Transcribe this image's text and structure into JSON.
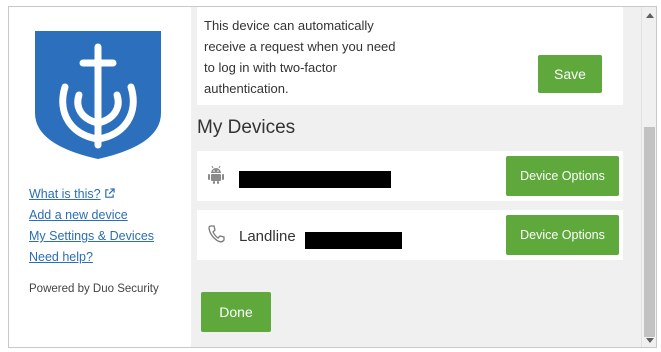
{
  "left_panel": {
    "links": [
      {
        "label": "What is this?",
        "name": "what-is-this-link",
        "external": true
      },
      {
        "label": "Add a new device",
        "name": "add-new-device-link",
        "external": false
      },
      {
        "label": "My Settings & Devices",
        "name": "my-settings-devices-link",
        "external": false
      },
      {
        "label": "Need help?",
        "name": "need-help-link",
        "external": false
      }
    ],
    "powered_by": "Powered by Duo Security"
  },
  "auto_push": {
    "text_lines": [
      "This device can automatically",
      "receive a request when you need",
      "to log in with two-factor",
      "authentication."
    ],
    "save_label": "Save"
  },
  "devices": {
    "title": "My Devices",
    "items": [
      {
        "icon": "android-icon",
        "label": "",
        "redacted": true,
        "button_label": "Device Options"
      },
      {
        "icon": "phone-icon",
        "label": "Landline",
        "redacted": true,
        "button_label": "Device Options"
      }
    ]
  },
  "done_label": "Done",
  "colors": {
    "accent_green": "#5ea83c",
    "link_blue": "#2a6eb7",
    "logo_blue": "#2b6fbd"
  }
}
